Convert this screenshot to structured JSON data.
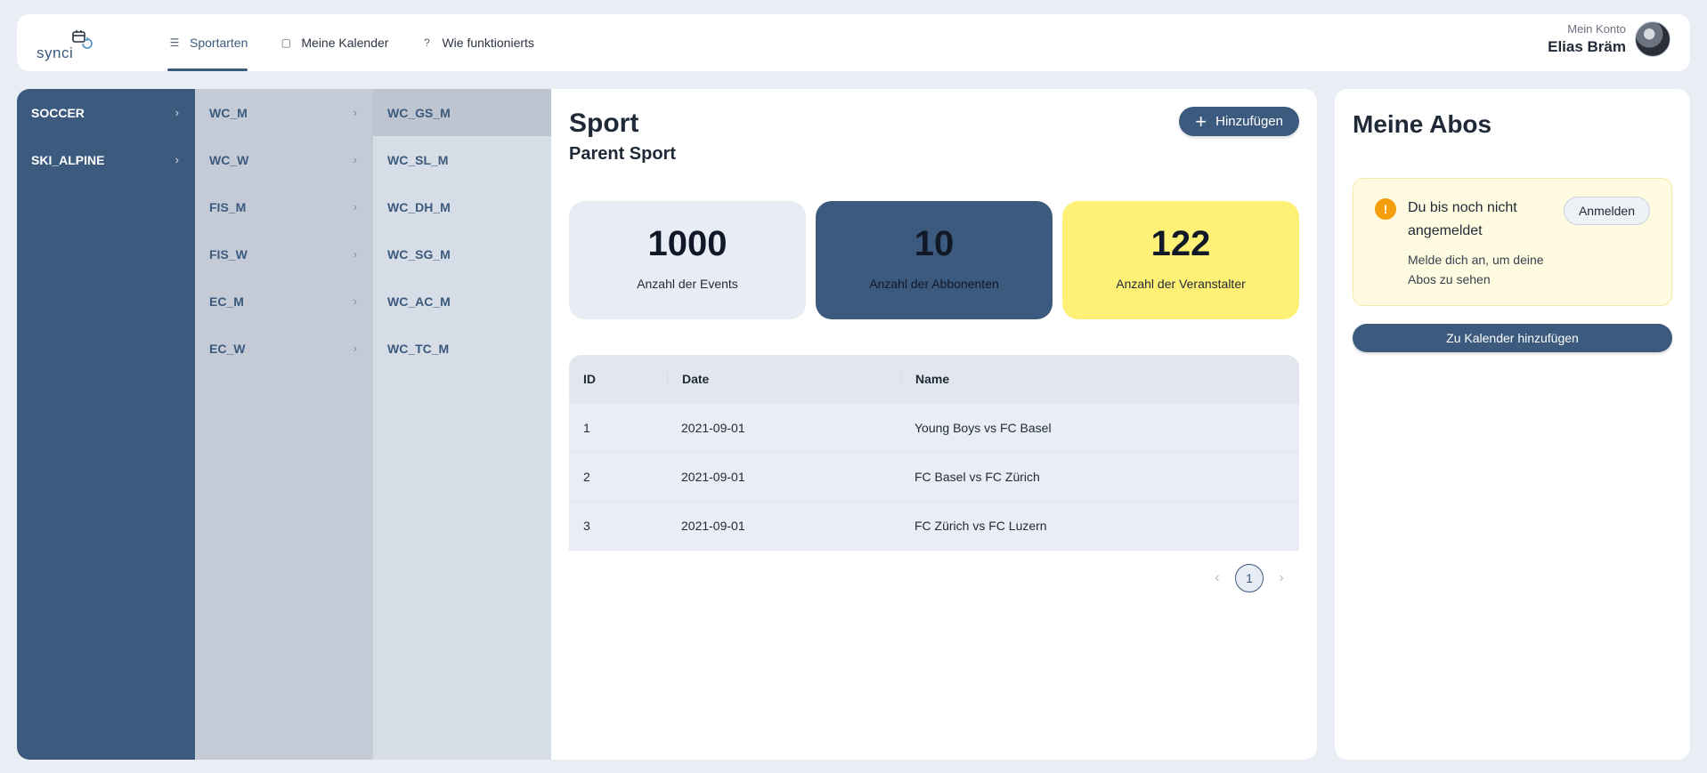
{
  "brand": {
    "logo_text": "synci"
  },
  "nav": [
    {
      "label": "Sportarten",
      "icon": "list-icon"
    },
    {
      "label": "Meine Kalender",
      "icon": "calendar-icon"
    },
    {
      "label": "Wie funktionierts",
      "icon": "question-icon"
    }
  ],
  "account": {
    "label": "Mein Konto",
    "name": "Elias Bräm"
  },
  "sports": [
    {
      "label": "SOCCER"
    },
    {
      "label": "SKI_ALPINE"
    }
  ],
  "categories": [
    {
      "label": "WC_M"
    },
    {
      "label": "WC_W"
    },
    {
      "label": "FIS_M"
    },
    {
      "label": "FIS_W"
    },
    {
      "label": "EC_M"
    },
    {
      "label": "EC_W"
    }
  ],
  "subcategories": [
    {
      "label": "WC_GS_M"
    },
    {
      "label": "WC_SL_M"
    },
    {
      "label": "WC_DH_M"
    },
    {
      "label": "WC_SG_M"
    },
    {
      "label": "WC_AC_M"
    },
    {
      "label": "WC_TC_M"
    }
  ],
  "content": {
    "title": "Sport",
    "subtitle": "Parent Sport",
    "add_label": "Hinzufügen"
  },
  "stats": [
    {
      "value": "1000",
      "label": "Anzahl der Events"
    },
    {
      "value": "10",
      "label": "Anzahl der Abbonenten"
    },
    {
      "value": "122",
      "label": "Anzahl der Veranstalter"
    }
  ],
  "table": {
    "headers": [
      "ID",
      "Date",
      "Name"
    ],
    "rows": [
      [
        "1",
        "2021-09-01",
        "Young Boys vs FC Basel"
      ],
      [
        "2",
        "2021-09-01",
        "FC Basel vs FC Zürich"
      ],
      [
        "3",
        "2021-09-01",
        "FC Zürich vs FC Luzern"
      ]
    ]
  },
  "pagination": {
    "prev": "‹",
    "page": "1",
    "next": "›"
  },
  "side": {
    "title": "Meine Abos",
    "alert_title": "Du bis noch nicht angemeldet",
    "alert_text": "Melde dich an, um deine Abos zu sehen",
    "login_label": "Anmelden",
    "calendar_button": "Zu Kalender hinzufügen"
  },
  "colors": {
    "primary": "#3c5a7e",
    "accent_yellow": "#fff176",
    "warning": "#f59e0b"
  }
}
